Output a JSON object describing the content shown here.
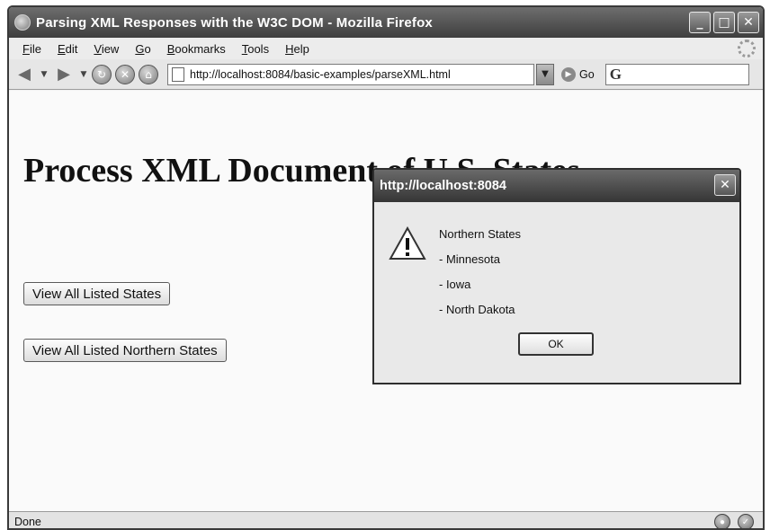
{
  "window": {
    "title": "Parsing XML Responses with the W3C DOM - Mozilla Firefox",
    "controls": {
      "minimize": "_",
      "maximize": "□",
      "close": "✕"
    }
  },
  "menu": {
    "items": [
      {
        "key": "F",
        "rest": "ile"
      },
      {
        "key": "E",
        "rest": "dit"
      },
      {
        "key": "V",
        "rest": "iew"
      },
      {
        "key": "G",
        "rest": "o"
      },
      {
        "key": "B",
        "rest": "ookmarks"
      },
      {
        "key": "T",
        "rest": "ools"
      },
      {
        "key": "H",
        "rest": "elp"
      }
    ]
  },
  "nav": {
    "url": "http://localhost:8084/basic-examples/parseXML.html",
    "go_label": "Go",
    "search_logo": "G"
  },
  "page": {
    "heading": "Process XML Document of U.S. States",
    "buttons": {
      "view_all": "View All Listed States",
      "view_northern": "View All Listed Northern States"
    }
  },
  "dialog": {
    "title": "http://localhost:8084",
    "message_lines": [
      "Northern States",
      "- Minnesota",
      "- Iowa",
      "- North Dakota"
    ],
    "ok_label": "OK"
  },
  "status": {
    "text": "Done"
  }
}
